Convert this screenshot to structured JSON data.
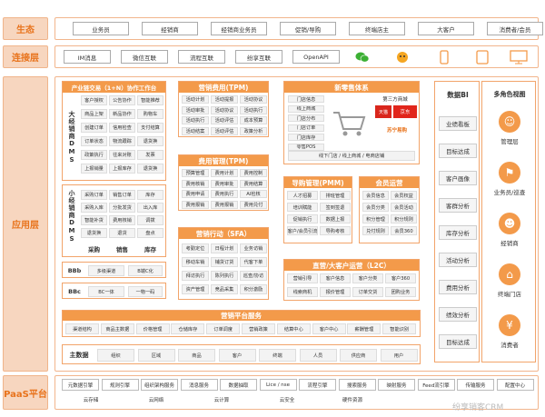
{
  "layers": {
    "ecology": "生态",
    "connect": "连接层",
    "app": "应用层",
    "paas": "PaaS平台"
  },
  "ecology_items": [
    "业务员",
    "经销商",
    "经销商业务员",
    "促销/导购",
    "终端店主",
    "大客户",
    "消费者/会员"
  ],
  "connect_items": [
    "IM消息",
    "微信互联",
    "流程互联",
    "纷享互联",
    "OpenAPI"
  ],
  "connect_icons": [
    "wechat-icon",
    "mascot-icon",
    "phone-icon",
    "tablet-icon",
    "monitor-icon"
  ],
  "industry_chain": {
    "title": "产业链交易（1+N）协作工作台",
    "side": "大经销商DMS",
    "cells": [
      "客户授权",
      "公告协作",
      "智能推荐",
      "商品上架",
      "新品协作",
      "购物车",
      "创建订单",
      "信用检查",
      "支付结算",
      "订单状态",
      "物流跟踪",
      "退货换",
      "政策执行",
      "往来对账",
      "发票",
      "上报销量",
      "上报库存",
      "退货换"
    ]
  },
  "small_dms": {
    "side": "小经销商DMS",
    "cells": [
      "采购订单",
      "销售订单",
      "库存",
      "采购入库",
      "分批发货",
      "出入库",
      "智能补货",
      "费用核销",
      "调拨",
      "退货换",
      "退货",
      "盘点"
    ],
    "footer": [
      "采购",
      "销售",
      "库存"
    ]
  },
  "bbb": {
    "label": "BBb",
    "items": [
      "多级渠道",
      "B端C化"
    ]
  },
  "bbc": {
    "label": "BBc",
    "items": [
      "BC一体",
      "一物一码"
    ]
  },
  "tpm1": {
    "title": "营销费用(TPM)",
    "cells": [
      "活动计划",
      "活动提报",
      "活动协议",
      "活动审批",
      "活动协议",
      "活动执行",
      "活动执行",
      "活动评估",
      "成本预算",
      "活动结案",
      "活动评估",
      "政策分析"
    ]
  },
  "tpm2": {
    "title": "费用管理(TPM)",
    "cells": [
      "预算管理",
      "费用计划",
      "费用控制",
      "费用核销",
      "费用审批",
      "费用结算",
      "费用申请",
      "费用执行",
      "AI检核",
      "费用报销",
      "费用报销",
      "费用兑付"
    ]
  },
  "sfa": {
    "title": "营销行动（SFA）",
    "cells": [
      "考勤定位",
      "日程计划",
      "业务访销",
      "移动车销",
      "铺货订货",
      "代客下单",
      "拜访执行",
      "陈列执行",
      "巡查/协访",
      "资产管理",
      "竞品采集",
      "积分激励"
    ]
  },
  "retail": {
    "title": "新零售体系",
    "cells": [
      "门店信息",
      "线上商城",
      "门店分布",
      "门店订单",
      "门店库存",
      "零售POS"
    ],
    "third_party": "第三方商城",
    "brands": [
      "天猫",
      "京东",
      "苏宁易购"
    ],
    "bar": "线下门店 / 线上商城 / 电商店铺"
  },
  "pmm": {
    "title": "导购管理(PMM)",
    "cells": [
      "人才招募",
      "排班管理",
      "培训赋能",
      "签到签退",
      "促销执行",
      "数据上报",
      "客户/会员引流",
      "导购考核"
    ]
  },
  "member": {
    "title": "会员运营",
    "cells": [
      "会员信息",
      "会员权益",
      "会员分类",
      "会员活动",
      "积分管理",
      "积分规则",
      "兑付规则",
      "会员360"
    ]
  },
  "l2c": {
    "title": "直营/大客户运营（L2C）",
    "cells": [
      "营销引导",
      "客户信息",
      "客户分类",
      "客户360",
      "线索商机",
      "报价管理",
      "订单交货",
      "团购业务"
    ]
  },
  "platform": {
    "title": "营销平台服务",
    "cells": [
      "渠道结构",
      "商品主数据",
      "价格管理",
      "仓储库存",
      "订单调度",
      "营销政策",
      "结算中心",
      "客户中心",
      "薪酬管理",
      "智能识别"
    ]
  },
  "master_data": {
    "label": "主数据",
    "items": [
      "组织",
      "区域",
      "商品",
      "客户",
      "终端",
      "人员",
      "供应商",
      "用户"
    ]
  },
  "bi": {
    "title": "数据BI",
    "items": [
      "业绩看板",
      "目标达成",
      "客户画像",
      "客群分析",
      "库存分析",
      "活动分析",
      "费用分析",
      "绩效分析",
      "目标达成"
    ]
  },
  "roles": {
    "title": "多角色视图",
    "items": [
      "管理层",
      "业务员/巡查",
      "经销商",
      "终端门店",
      "消费者"
    ]
  },
  "paas_row1": [
    "元数据引擎",
    "规则引擎",
    "组织架构服务",
    "消息服务",
    "数据抽取",
    "Lice / nse",
    "流程引擎",
    "搜索服务",
    "映射服务",
    "Feed流引擎",
    "传输服务",
    "配置中心"
  ],
  "paas_row2": [
    "云存储",
    "云网络",
    "云计算",
    "云安全",
    "硬件资源"
  ],
  "watermark": "纷享销客CRM"
}
